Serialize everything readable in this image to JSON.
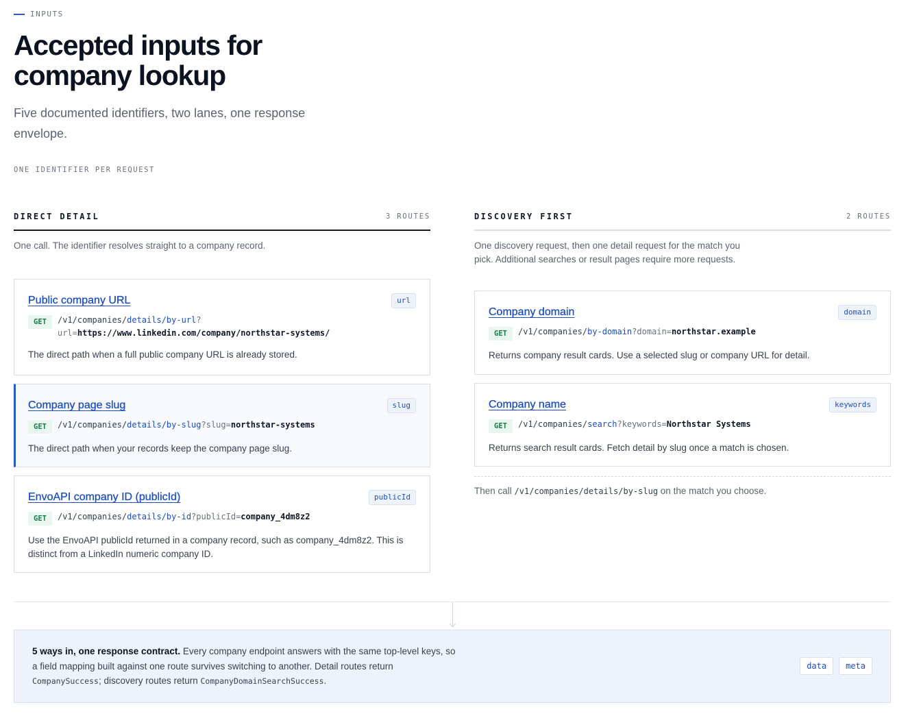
{
  "header": {
    "eyebrow": "INPUTS",
    "title": "Accepted inputs for company lookup",
    "lead": "Five documented identifiers, two lanes, one response envelope.",
    "tagline": "ONE IDENTIFIER PER REQUEST"
  },
  "lanes": [
    {
      "name": "DIRECT DETAIL",
      "count": "3 ROUTES",
      "description": "One call. The identifier resolves straight to a company record.",
      "cards": [
        {
          "title": "Public company URL",
          "badge": "url",
          "method": "GET",
          "path_prefix": "/v1/companies/",
          "path_segment": "details/by-url",
          "query_key": "?url=",
          "query_value": "https://www.linkedin.com/company/northstar-systems/",
          "description": "The direct path when a full public company URL is already stored."
        },
        {
          "title": "Company page slug",
          "badge": "slug",
          "method": "GET",
          "path_prefix": "/v1/companies/",
          "path_segment": "details/by-slug",
          "query_key": "?slug=",
          "query_value": "northstar-systems",
          "description": "The direct path when your records keep the company page slug.",
          "active": true
        },
        {
          "title": "EnvoAPI company ID (publicId)",
          "badge": "publicId",
          "method": "GET",
          "path_prefix": "/v1/companies/",
          "path_segment": "details/by-id",
          "query_key": "?publicId=",
          "query_value": "company_4dm8z2",
          "description": "Use the EnvoAPI publicId returned in a company record, such as company_4dm8z2. This is distinct from a LinkedIn numeric company ID."
        }
      ]
    },
    {
      "name": "DISCOVERY FIRST",
      "count": "2 ROUTES",
      "description": "One discovery request, then one detail request for the match you pick. Additional searches or result pages require more requests.",
      "cards": [
        {
          "title": "Company domain",
          "badge": "domain",
          "method": "GET",
          "path_prefix": "/v1/companies/",
          "path_segment": "by-domain",
          "query_key": "?domain=",
          "query_value": "northstar.example",
          "description": "Returns company result cards. Use a selected slug or company URL for detail."
        },
        {
          "title": "Company name",
          "badge": "keywords",
          "method": "GET",
          "path_prefix": "/v1/companies/",
          "path_segment": "search",
          "query_key": "?keywords=",
          "query_value": "Northstar Systems",
          "description": "Returns search result cards. Fetch detail by slug once a match is chosen."
        }
      ],
      "then_prefix": "Then call ",
      "then_code": "/v1/companies/details/by-slug",
      "then_suffix": " on the match you choose."
    }
  ],
  "contract": {
    "lead": "5 ways in, one response contract.",
    "text_1": " Every company endpoint answers with the same top-level keys, so a field mapping built against one route survives switching to another. Detail routes return ",
    "code_1": "CompanySuccess",
    "text_2": "; discovery routes return ",
    "code_2": "CompanyDomainSearchSuccess",
    "text_3": ".",
    "keys": [
      "data",
      "meta"
    ]
  },
  "colors": {
    "accent": "#1d4fc4",
    "get_text": "#1f7a4d",
    "get_bg": "#e8f6ee",
    "contract_bg": "#eef3fb"
  }
}
